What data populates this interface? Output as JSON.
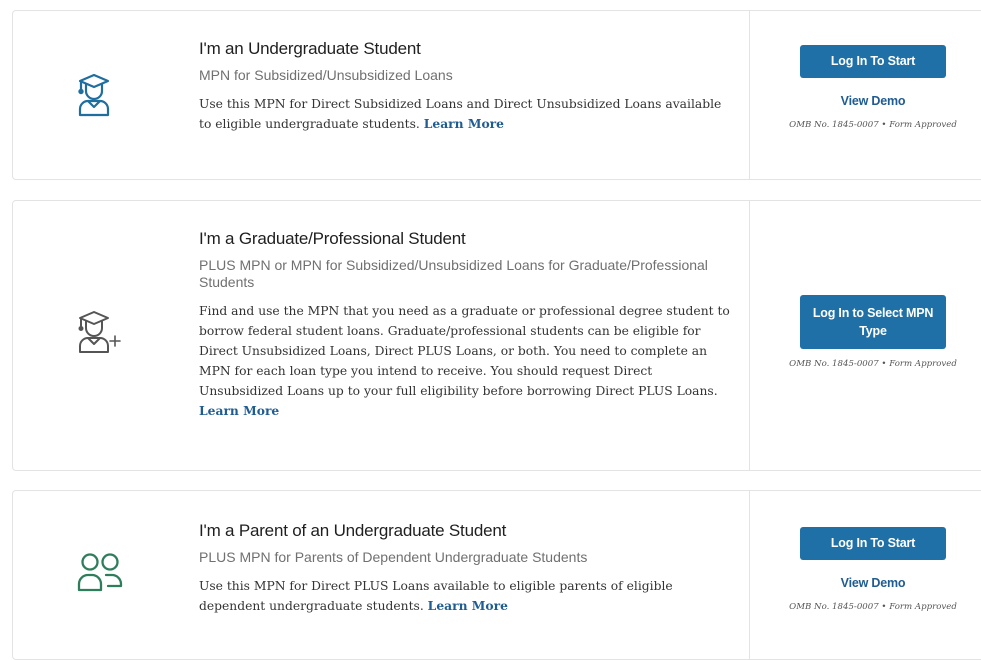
{
  "cards": [
    {
      "title": "I'm an Undergraduate Student",
      "subtitle": "MPN for Subsidized/Unsubsidized Loans",
      "description": "Use this MPN for Direct Subsidized Loans and Direct Unsubsidized Loans available to eligible undergraduate students.",
      "learn_more": "Learn More",
      "button_label": "Log In To Start",
      "demo_label": "View Demo",
      "omb": "OMB No. 1845-0007  •  Form Approved",
      "icon": "graduate-student-icon",
      "icon_color": "#1f6e9e"
    },
    {
      "title": "I'm a Graduate/Professional Student",
      "subtitle": "PLUS MPN or MPN for Subsidized/Unsubsidized Loans for Graduate/Professional Students",
      "description": "Find and use the MPN that you need as a graduate or professional degree student to borrow federal student loans. Graduate/professional students can be eligible for Direct Unsubsidized Loans, Direct PLUS Loans, or both. You need to complete an MPN for each loan type you intend to receive. You should request Direct Unsubsidized Loans up to your full eligibility before borrowing Direct PLUS Loans.",
      "learn_more": "Learn More",
      "button_label": "Log In to Select MPN Type",
      "omb": "OMB No. 1845-0007  •  Form Approved",
      "icon": "graduate-student-plus-icon",
      "icon_color": "#555555"
    },
    {
      "title": "I'm a Parent of an Undergraduate Student",
      "subtitle": "PLUS MPN for Parents of Dependent Undergraduate Students",
      "description": "Use this MPN for Direct PLUS Loans available to eligible parents of eligible dependent undergraduate students.",
      "learn_more": "Learn More",
      "button_label": "Log In To Start",
      "demo_label": "View Demo",
      "omb": "OMB No. 1845-0007  •  Form Approved",
      "icon": "parent-users-icon",
      "icon_color": "#2e7d5b"
    }
  ],
  "colors": {
    "button": "#1f70a6",
    "link": "#1f5c91"
  }
}
